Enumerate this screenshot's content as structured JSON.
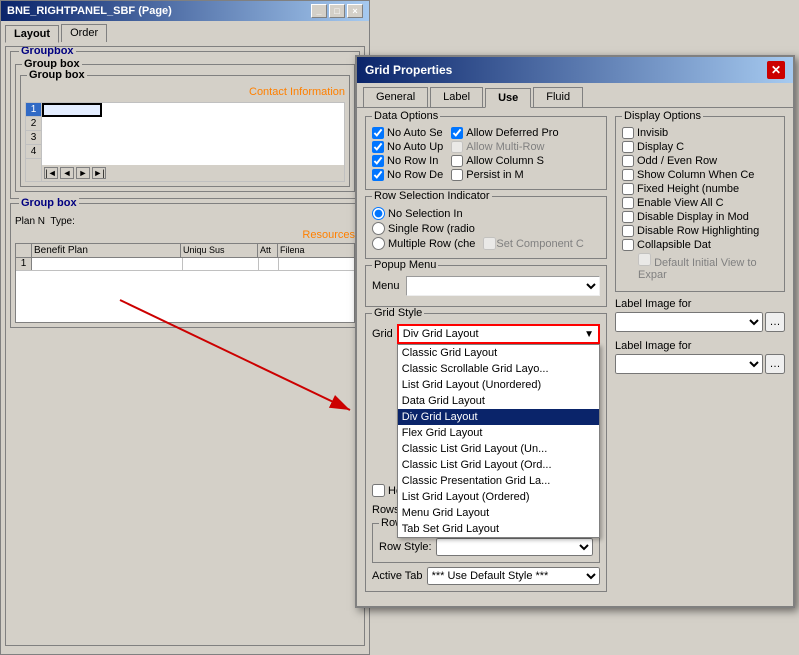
{
  "mainWindow": {
    "title": "BNE_RIGHTPANEL_SBF (Page)",
    "tabs": [
      "Layout",
      "Order"
    ]
  },
  "leftPanel": {
    "groupbox1": {
      "title": "Groupbox",
      "innerTitle": "Group box",
      "deepTitle": "Group box",
      "contactLabel": "Contact Information",
      "gridRows": [
        "2",
        "3",
        "4"
      ]
    },
    "groupbox2": {
      "title": "Group box",
      "planLabel": "Plan N",
      "typeLabel": "Type:",
      "resourcesLabel": "Resources",
      "columns": [
        "Benefit Plan",
        "Uniqu Sus",
        "Att",
        "Filena"
      ],
      "dataRows": [
        "1"
      ]
    }
  },
  "dialog": {
    "title": "Grid Properties",
    "tabs": [
      "General",
      "Label",
      "Use",
      "Fluid"
    ],
    "activeTab": "Use",
    "leftSection": {
      "dataOptionsTitle": "Data Options",
      "checkboxes": [
        {
          "label": "No Auto Se",
          "checked": true
        },
        {
          "label": "No Auto Up",
          "checked": true
        },
        {
          "label": "No Row In",
          "checked": true
        },
        {
          "label": "No Row De",
          "checked": true
        }
      ],
      "rightCheckboxes": [
        {
          "label": "Allow Deferred Pro",
          "checked": true
        },
        {
          "label": "Allow Multi-Row",
          "checked": false,
          "disabled": true
        },
        {
          "label": "Allow Column S",
          "checked": false
        },
        {
          "label": "Persist in M",
          "checked": false
        }
      ],
      "rowSelectionTitle": "Row Selection Indicator",
      "radioOptions": [
        {
          "label": "No Selection In",
          "checked": true
        },
        {
          "label": "Single Row (radio",
          "checked": false
        },
        {
          "label": "Multiple Row (che",
          "checked": false
        }
      ],
      "setComponentLabel": "Set Component C",
      "popupMenuTitle": "Popup Menu",
      "menuLabel": "Menu",
      "gridStyleTitle": "Grid Style",
      "gridLabel": "Grid",
      "selectedGridStyle": "Div Grid Layout",
      "dropdownItems": [
        "Classic Grid Layout",
        "Classic Scrollable Grid Layo...",
        "List Grid Layout (Unordered)",
        "Data Grid Layout",
        "Div Grid Layout",
        "Flex Grid Layout",
        "Classic List Grid Layout (Un...",
        "Classic List Grid Layout (Ord...",
        "Classic Presentation Grid La...",
        "List Grid Layout (Ordered)",
        "Menu Grid Layout",
        "Tab Set Grid Layout"
      ],
      "horizCheckbox": "Horizor",
      "rowsToShowLabel": "Rows to show in",
      "rowStylesTitle": "Row Styles",
      "rowStyleLabel": "Row Style:",
      "activeTabLabel": "Active Tab",
      "activeTabValue": "*** Use Default Style ***"
    },
    "rightSection": {
      "displayOptionsTitle": "Display Options",
      "checkboxes": [
        {
          "label": "Invisib",
          "checked": false
        },
        {
          "label": "Display C",
          "checked": false
        },
        {
          "label": "Odd / Even Row",
          "checked": false
        },
        {
          "label": "Show Column When Ce",
          "checked": false
        },
        {
          "label": "Fixed Height (numbe",
          "checked": false
        },
        {
          "label": "Enable View All C",
          "checked": false
        },
        {
          "label": "Disable Display in Mod",
          "checked": false
        },
        {
          "label": "Disable Row Highlighting",
          "checked": false
        },
        {
          "label": "Collapsible Dat",
          "checked": false
        }
      ],
      "defaultInitialLabel": "Default Initial View to Expar",
      "labelImageFor1": "Label Image for",
      "labelImageFor2": "Label Image for"
    }
  }
}
